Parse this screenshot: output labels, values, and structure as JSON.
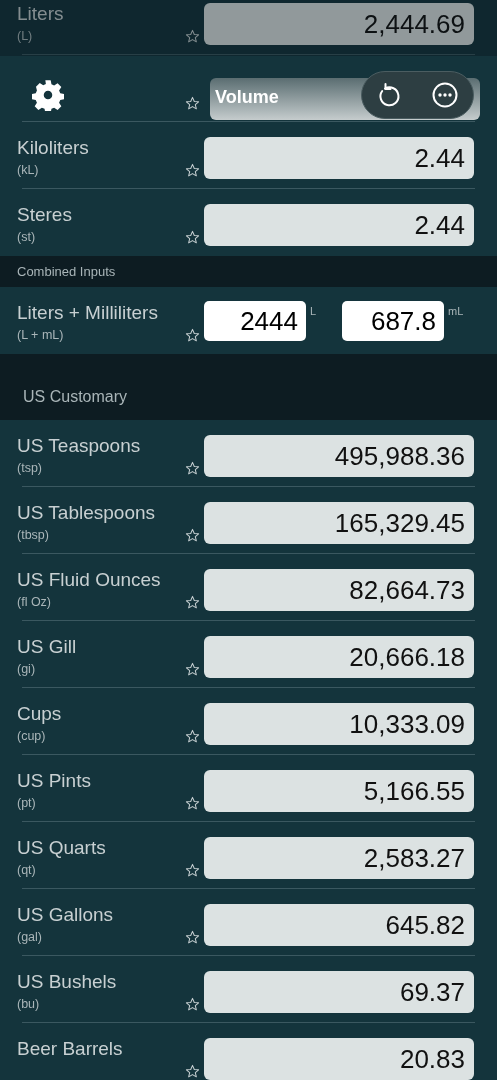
{
  "toolbar": {
    "title": "Volume"
  },
  "metric_rows": [
    {
      "name": "Liters",
      "unit": "(L)",
      "value": "2,444.69"
    },
    {
      "kind": "covered"
    },
    {
      "name": "Kiloliters",
      "unit": "(kL)",
      "value": "2.44"
    },
    {
      "name": "Steres",
      "unit": "(st)",
      "value": "2.44"
    }
  ],
  "combined_inputs": {
    "title": "Combined Inputs",
    "rows": [
      {
        "name": "Liters + Milliliters",
        "unit": "(L + mL)",
        "inputs": [
          {
            "value": "2444",
            "suffix": "L"
          },
          {
            "value": "687.8",
            "suffix": "mL"
          }
        ]
      }
    ]
  },
  "us_customary": {
    "title": "US Customary",
    "rows": [
      {
        "name": "US Teaspoons",
        "unit": "(tsp)",
        "value": "495,988.36"
      },
      {
        "name": "US Tablespoons",
        "unit": "(tbsp)",
        "value": "165,329.45"
      },
      {
        "name": "US Fluid Ounces",
        "unit": "(fl Oz)",
        "value": "82,664.73"
      },
      {
        "name": "US Gill",
        "unit": "(gi)",
        "value": "20,666.18"
      },
      {
        "name": "Cups",
        "unit": "(cup)",
        "value": "10,333.09"
      },
      {
        "name": "US Pints",
        "unit": "(pt)",
        "value": "5,166.55"
      },
      {
        "name": "US Quarts",
        "unit": "(qt)",
        "value": "2,583.27"
      },
      {
        "name": "US Gallons",
        "unit": "(gal)",
        "value": "645.82"
      },
      {
        "name": "US Bushels",
        "unit": "(bu)",
        "value": "69.37"
      },
      {
        "name": "Beer Barrels",
        "value": "20.83"
      }
    ]
  }
}
